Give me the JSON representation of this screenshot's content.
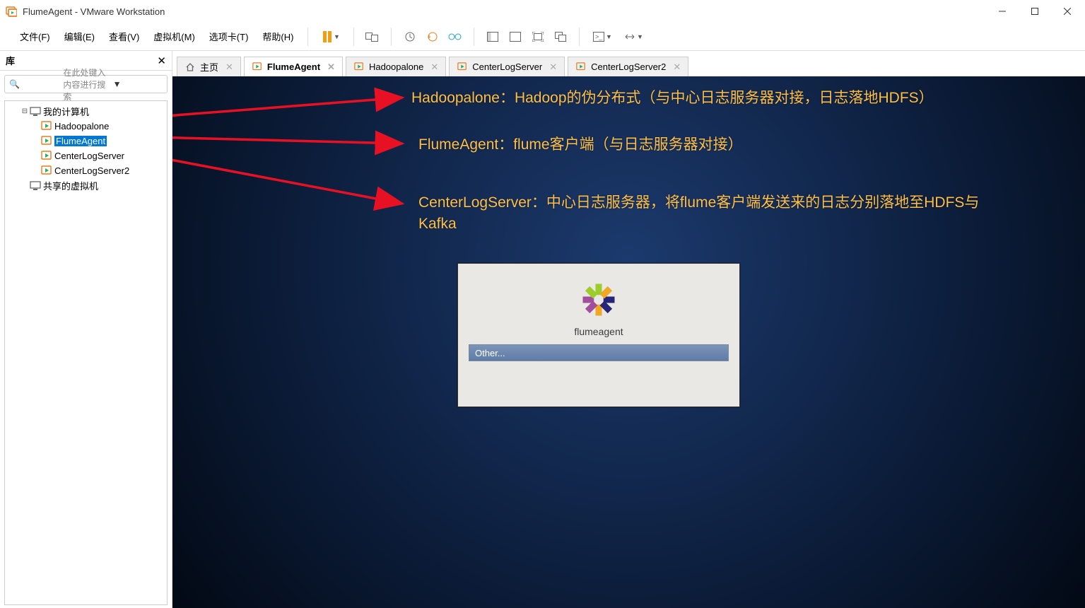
{
  "window": {
    "title": "FlumeAgent - VMware Workstation"
  },
  "menu": {
    "file": "文件(F)",
    "edit": "编辑(E)",
    "view": "查看(V)",
    "vm": "虚拟机(M)",
    "tabs": "选项卡(T)",
    "help": "帮助(H)"
  },
  "toolbar_icons": {
    "pause": "pause",
    "screenshot": "screenshot",
    "revert": "revert-snapshot",
    "snapshot": "take-snapshot",
    "manage_snapshot": "manage-snapshot",
    "layout_left": "layout-left",
    "layout_single": "layout-single",
    "fullscreen": "fullscreen",
    "unity": "unity",
    "console": "console",
    "stretch": "stretch"
  },
  "sidebar": {
    "title": "库",
    "search_placeholder": "在此处键入内容进行搜索",
    "my_computer": "我的计算机",
    "items": [
      "Hadoopalone",
      "FlumeAgent",
      "CenterLogServer",
      "CenterLogServer2"
    ],
    "shared": "共享的虚拟机"
  },
  "tabs": {
    "home": "主页",
    "t1": "FlumeAgent",
    "t2": "Hadoopalone",
    "t3": "CenterLogServer",
    "t4": "CenterLogServer2"
  },
  "annotations": {
    "a1": "Hadoopalone：Hadoop的伪分布式（与中心日志服务器对接，日志落地HDFS）",
    "a2": "FlumeAgent：flume客户端（与日志服务器对接）",
    "a3": "CenterLogServer：中心日志服务器，将flume客户端发送来的日志分别落地至HDFS与Kafka"
  },
  "centos": {
    "host": "flumeagent",
    "other": "Other..."
  },
  "colors": {
    "accent_blue": "#0078d4",
    "annotation_yellow": "#ffbf47",
    "arrow_red": "#e81123"
  }
}
